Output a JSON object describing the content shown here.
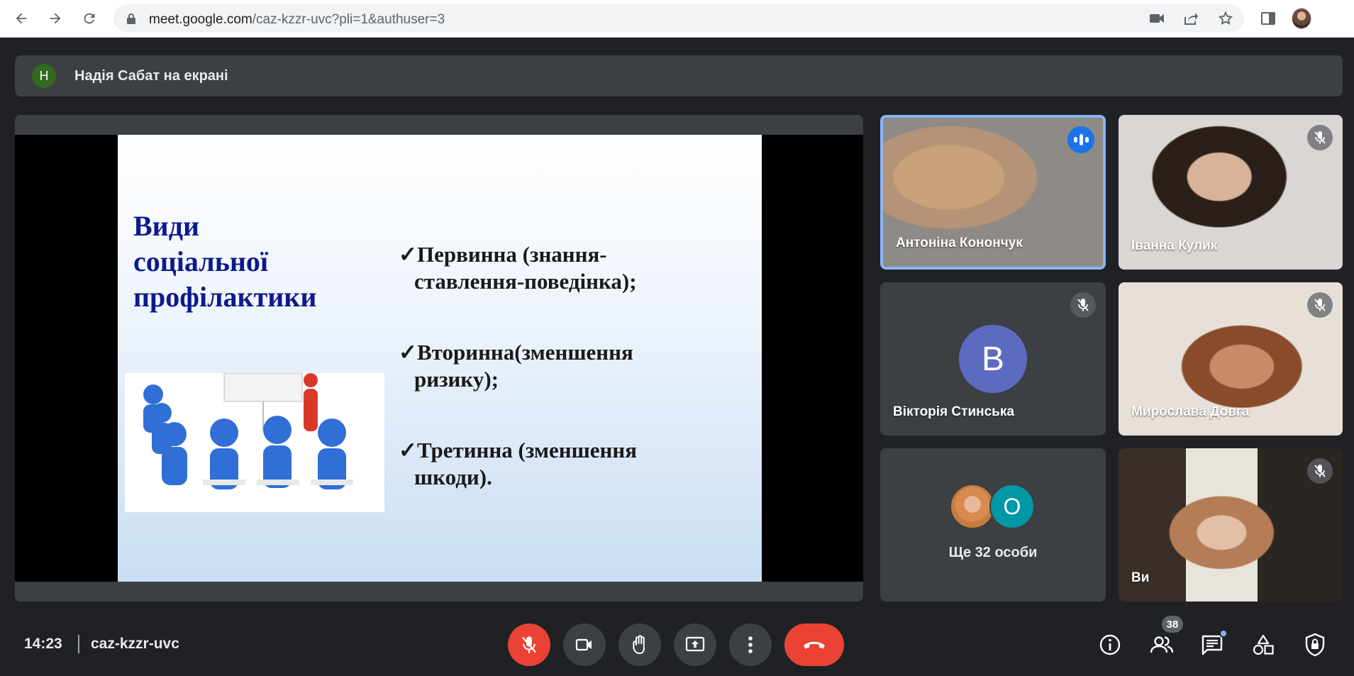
{
  "browser": {
    "url_host": "meet.google.com",
    "url_path": "/caz-kzzr-uvc?pli=1&authuser=3",
    "icons": [
      "back-arrow-icon",
      "forward-arrow-icon",
      "reload-icon",
      "lock-icon",
      "camera-blocked-icon",
      "share-icon",
      "star-icon",
      "sidepanel-icon",
      "profile-avatar"
    ]
  },
  "banner": {
    "avatar_letter": "Н",
    "avatar_color": "#33691e",
    "text": "Надія Сабат на екрані"
  },
  "slide": {
    "title_lines": [
      "Види",
      "соціальної",
      "профілактики"
    ],
    "bullets": [
      {
        "line1": "✓Первинна (знання-",
        "line2": "ставлення-поведінка);"
      },
      {
        "line1": "✓Вторинна(зменшення",
        "line2": "ризику);"
      },
      {
        "line1": "✓Третинна (зменшення",
        "line2": "шкоди)."
      }
    ]
  },
  "participants": [
    {
      "name": "Антоніна Конончук",
      "speaking": true
    },
    {
      "name": "Іванна Кулик",
      "muted": true
    },
    {
      "name": "Вікторія Стинська",
      "muted": true,
      "avatar_letter": "В",
      "avatar_color": "#5c6bc0"
    },
    {
      "name": "Мирослава Довга",
      "muted": true
    },
    {
      "more_label": "Ще 32 особи",
      "avatar_letter": "О",
      "avatar_color": "#0097a7"
    },
    {
      "name": "Ви",
      "muted": true
    }
  ],
  "bottom": {
    "time": "14:23",
    "meeting_code": "caz-kzzr-uvc",
    "people_count": "38",
    "end_color": "#ea4335",
    "mic_off_color": "#ea4335"
  }
}
